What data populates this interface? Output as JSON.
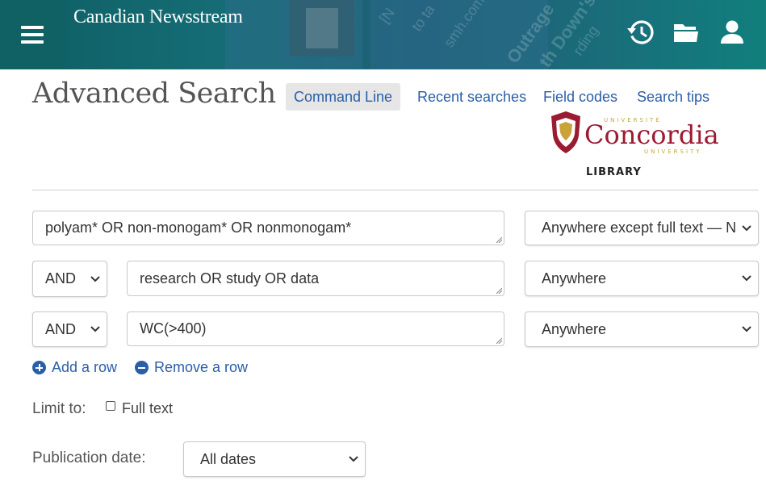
{
  "header": {
    "brand": "Canadian Newsstream",
    "icons": [
      "menu-icon",
      "history-icon",
      "folder-icon",
      "user-icon"
    ],
    "colors": {
      "bar": "#116468",
      "accent": "#2a5fa8"
    }
  },
  "page": {
    "title": "Advanced Search",
    "tabs": [
      {
        "label": "Command Line",
        "active": true
      },
      {
        "label": "Recent searches",
        "active": false
      },
      {
        "label": "Field codes",
        "active": false
      },
      {
        "label": "Search tips",
        "active": false
      }
    ]
  },
  "logo": {
    "top": "UNIVERSITÉ",
    "name": "Concordia",
    "sub": "UNIVERSITY",
    "library": "LIBRARY"
  },
  "search": {
    "rows": [
      {
        "operator": null,
        "query": "polyam* OR non-monogam* OR nonmonogam*",
        "field": "Anywhere except full text — N"
      },
      {
        "operator": "AND",
        "query": "research OR study OR data",
        "field": "Anywhere"
      },
      {
        "operator": "AND",
        "query": "WC(>400)",
        "field": "Anywhere"
      }
    ],
    "add_row": "Add a row",
    "remove_row": "Remove a row"
  },
  "limits": {
    "limit_label": "Limit to:",
    "full_text_label": "Full text",
    "full_text_checked": false,
    "pub_date_label": "Publication date:",
    "pub_date_value": "All dates"
  }
}
